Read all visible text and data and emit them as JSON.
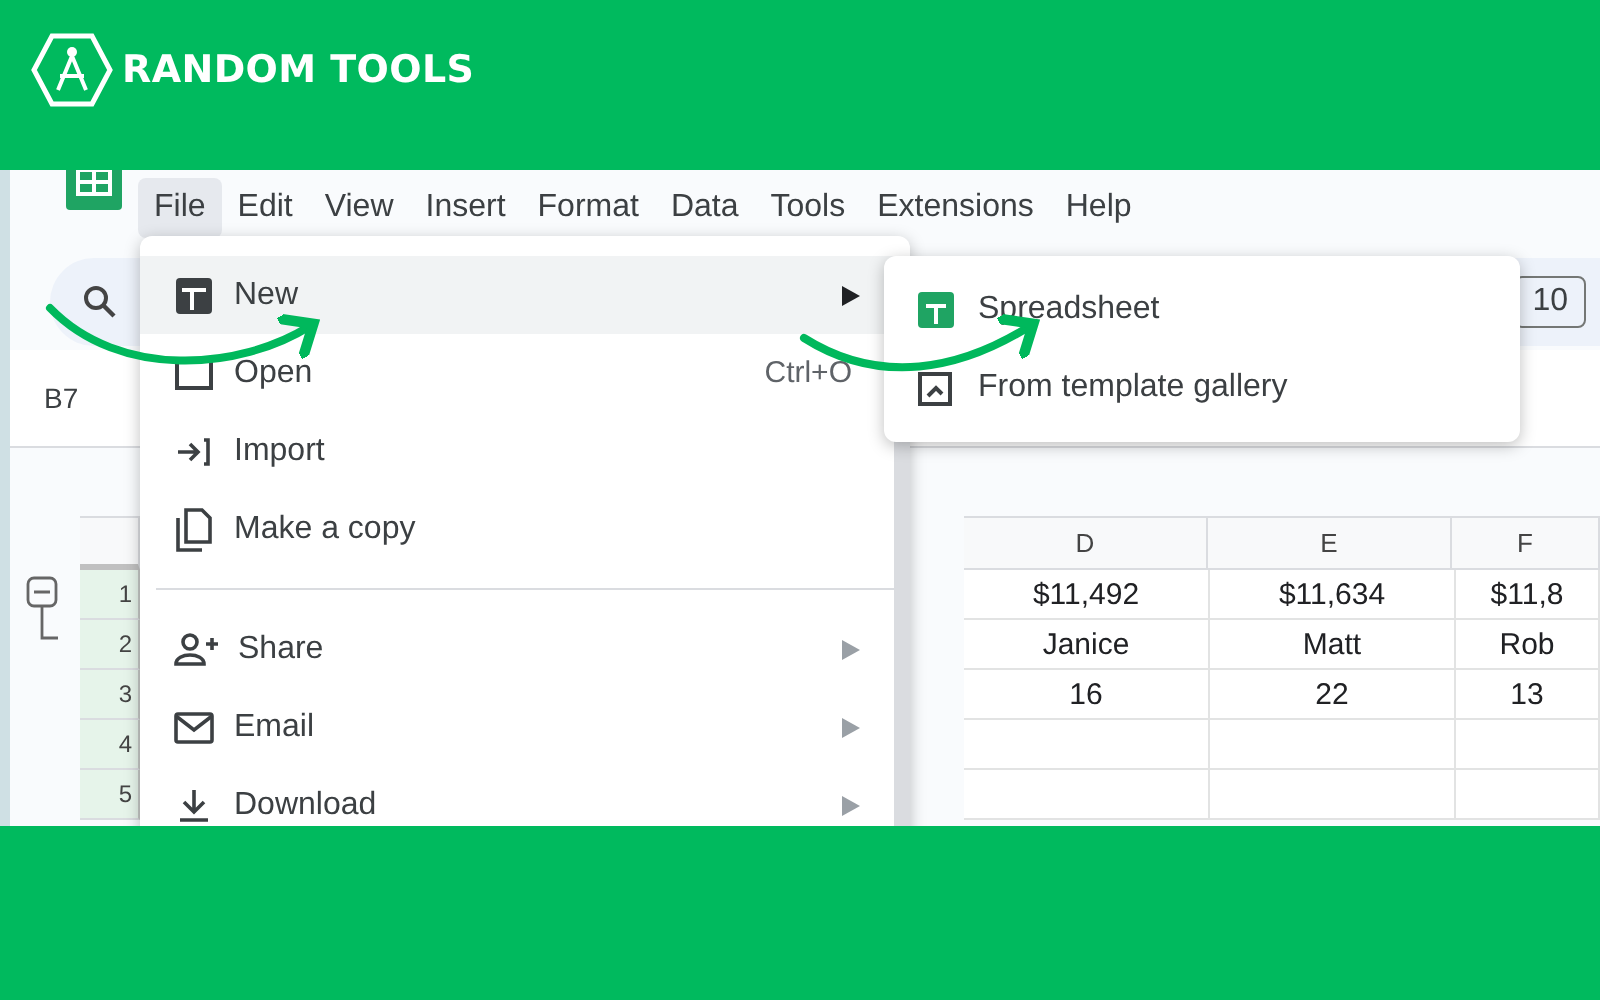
{
  "brand": {
    "name": "RANDOM TOOLS"
  },
  "menu_bar": [
    {
      "label": "File",
      "selected": true
    },
    {
      "label": "Edit",
      "selected": false
    },
    {
      "label": "View",
      "selected": false
    },
    {
      "label": "Insert",
      "selected": false
    },
    {
      "label": "Format",
      "selected": false
    },
    {
      "label": "Data",
      "selected": false
    },
    {
      "label": "Tools",
      "selected": false
    },
    {
      "label": "Extensions",
      "selected": false
    },
    {
      "label": "Help",
      "selected": false
    }
  ],
  "toolbar": {
    "font_size": "10"
  },
  "name_box": "B7",
  "file_menu": [
    {
      "kind": "item",
      "label": "New",
      "submenu": true,
      "selected": true
    },
    {
      "kind": "item",
      "label": "Open",
      "shortcut": "Ctrl+O",
      "submenu": false,
      "selected": false
    },
    {
      "kind": "item",
      "label": "Import",
      "submenu": false,
      "selected": false
    },
    {
      "kind": "item",
      "label": "Make a copy",
      "submenu": false,
      "selected": false
    },
    {
      "kind": "divider"
    },
    {
      "kind": "item",
      "label": "Share",
      "submenu": true,
      "selected": false
    },
    {
      "kind": "item",
      "label": "Email",
      "submenu": true,
      "selected": false
    },
    {
      "kind": "item",
      "label": "Download",
      "submenu": true,
      "selected": false
    }
  ],
  "new_submenu": [
    {
      "label": "Spreadsheet"
    },
    {
      "label": "From template gallery"
    }
  ],
  "sheet": {
    "columns": [
      "D",
      "E",
      "F"
    ],
    "rows": [
      {
        "number": "1",
        "cells": [
          "$11,492",
          "$11,634",
          "$11,8"
        ]
      },
      {
        "number": "2",
        "cells": [
          "Janice",
          "Matt",
          "Rob"
        ]
      },
      {
        "number": "3",
        "cells": [
          "16",
          "22",
          "13"
        ]
      },
      {
        "number": "4"
      },
      {
        "number": "5"
      }
    ]
  }
}
